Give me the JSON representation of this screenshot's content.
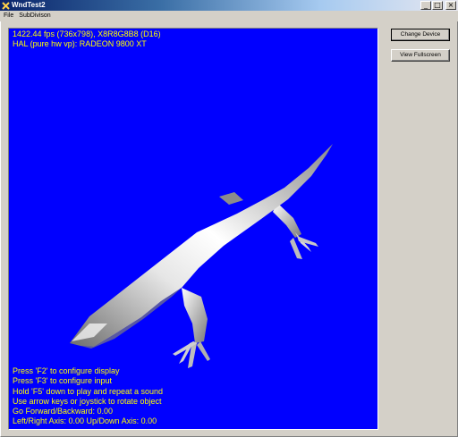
{
  "window": {
    "title": "WndTest2",
    "icon": "app-x-icon",
    "controls": {
      "minimize": "_",
      "maximize": "□",
      "close": "×"
    }
  },
  "menu": {
    "items": [
      {
        "label": "File"
      },
      {
        "label": "SubDivison"
      }
    ]
  },
  "viewport": {
    "background": "#0000ff",
    "text_color": "#ffff00",
    "stats": [
      "1422.44 fps (736x798), X8R8G8B8 (D16)",
      "HAL (pure hw vp): RADEON 9800 XT"
    ],
    "help": [
      "Press 'F2' to configure display",
      "Press 'F3' to configure input",
      "Hold 'F5' down to play and repeat a sound",
      "Use arrow keys or joystick to rotate object",
      "Go Forward/Backward: 0.00",
      "Left/Right Axis: 0.00 Up/Down Axis: 0.00"
    ],
    "model": "lizard-model"
  },
  "buttons": {
    "change_device": "Change Device",
    "view_fullscreen": "View Fullscreen"
  }
}
